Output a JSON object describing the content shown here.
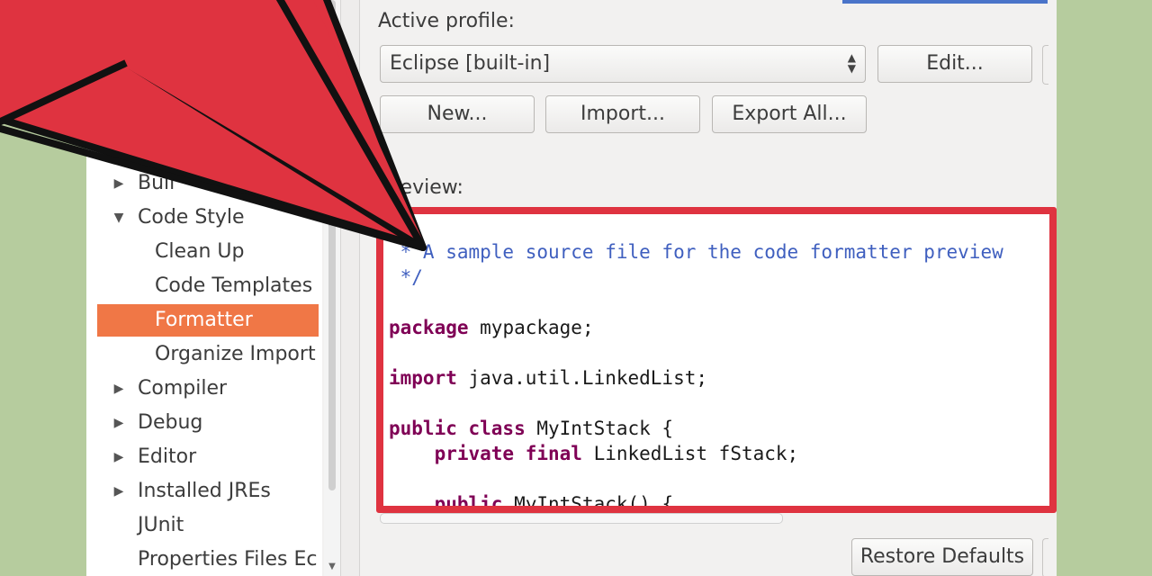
{
  "tree": {
    "items": [
      {
        "label": "Buil",
        "arrow": "▶"
      },
      {
        "label": "Code Style",
        "arrow": "▼"
      },
      {
        "label": "Clean Up",
        "arrow": ""
      },
      {
        "label": "Code Templates",
        "arrow": ""
      },
      {
        "label": "Formatter",
        "arrow": "",
        "selected": true
      },
      {
        "label": "Organize Import",
        "arrow": ""
      },
      {
        "label": "Compiler",
        "arrow": "▶"
      },
      {
        "label": "Debug",
        "arrow": "▶"
      },
      {
        "label": "Editor",
        "arrow": "▶"
      },
      {
        "label": "Installed JREs",
        "arrow": "▶"
      },
      {
        "label": "JUnit",
        "arrow": ""
      },
      {
        "label": "Properties Files Ec",
        "arrow": ""
      }
    ]
  },
  "profile": {
    "label": "Active profile:",
    "selected": "Eclipse [built-in]",
    "edit_button": "Edit...",
    "new_button": "New...",
    "import_button": "Import...",
    "export_button": "Export All..."
  },
  "preview": {
    "label": "review:",
    "code_lines": [
      {
        "text": "/*",
        "cls": "cm"
      },
      {
        "text": " * A sample source file for the code formatter preview",
        "cls": "cm"
      },
      {
        "text": " */",
        "cls": "cm"
      },
      {
        "text": "",
        "cls": ""
      },
      {
        "text": "package mypackage;",
        "cls": "",
        "kw": "package"
      },
      {
        "text": "",
        "cls": ""
      },
      {
        "text": "import java.util.LinkedList;",
        "cls": "",
        "kw": "import"
      },
      {
        "text": "",
        "cls": ""
      },
      {
        "text": "public class MyIntStack {",
        "cls": "",
        "kw": "public class"
      },
      {
        "text": "    private final LinkedList fStack;",
        "cls": "",
        "kw": "private final"
      },
      {
        "text": "",
        "cls": ""
      },
      {
        "text": "    public MyIntStack() {",
        "cls": "",
        "kw": "public"
      }
    ]
  },
  "footer": {
    "restore_defaults": "Restore Defaults"
  },
  "colors": {
    "accent_selection": "#f07746",
    "highlight_red": "#df3340",
    "background_green": "#b6cc9e"
  },
  "overlay": {
    "icon": "red-arrow-pointer"
  }
}
